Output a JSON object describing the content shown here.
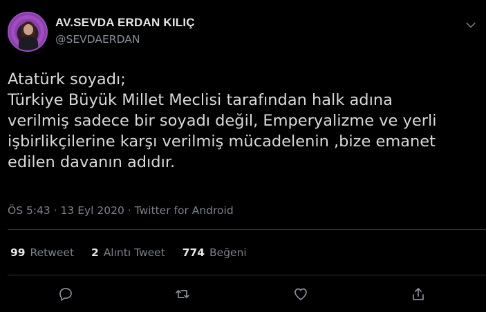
{
  "author": {
    "display_name": "AV.SEVDA ERDAN KILIÇ",
    "handle": "@SEVDAERDAN"
  },
  "tweet": {
    "lines": [
      "Atatürk soyadı;",
      "Türkiye Büyük Millet Meclisi tarafından halk adına",
      "verilmiş sadece bir soyadı değil, Emperyalizme ve yerli",
      "işbirlikçilerine karşı verilmiş mücadelenin ,bize emanet",
      "edilen davanın adıdır."
    ],
    "meta": "ÖS 5:43 · 13 Eyl 2020 · Twitter for Android"
  },
  "stats": {
    "retweets": {
      "count": "99",
      "label": "Retweet"
    },
    "quotes": {
      "count": "2",
      "label": "Alıntı Tweet"
    },
    "likes": {
      "count": "774",
      "label": "Beğeni"
    }
  },
  "icons": {
    "more": "chevron-down-icon",
    "reply": "reply-icon",
    "retweet": "retweet-icon",
    "like": "heart-icon",
    "share": "share-icon"
  },
  "colors": {
    "background": "#000000",
    "text": "#d9d9d9",
    "secondary_text": "#7d838b",
    "divider": "#2f3336",
    "avatar_accent": "#9c4ec0"
  }
}
